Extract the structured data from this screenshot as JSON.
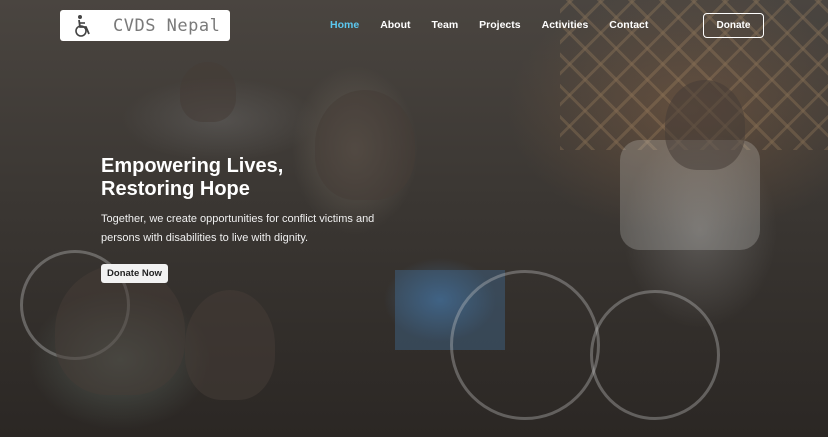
{
  "brand": {
    "logo_text": "CVDS Nepal",
    "logo_icon": "wheelchair-icon"
  },
  "nav": {
    "items": [
      {
        "label": "Home",
        "active": true
      },
      {
        "label": "About",
        "active": false
      },
      {
        "label": "Team",
        "active": false
      },
      {
        "label": "Projects",
        "active": false
      },
      {
        "label": "Activities",
        "active": false
      },
      {
        "label": "Contact",
        "active": false
      }
    ],
    "donate_label": "Donate"
  },
  "hero": {
    "headline_line1": "Empowering Lives,",
    "headline_line2": "Restoring Hope",
    "subtext_line1": "Together, we create opportunities for conflict victims and",
    "subtext_line2": "persons with disabilities to live with dignity.",
    "cta_label": "Donate Now"
  },
  "colors": {
    "active_nav": "#5bc8f0",
    "cta_bg": "#f2f2f2",
    "logo_bg": "#ffffff"
  }
}
